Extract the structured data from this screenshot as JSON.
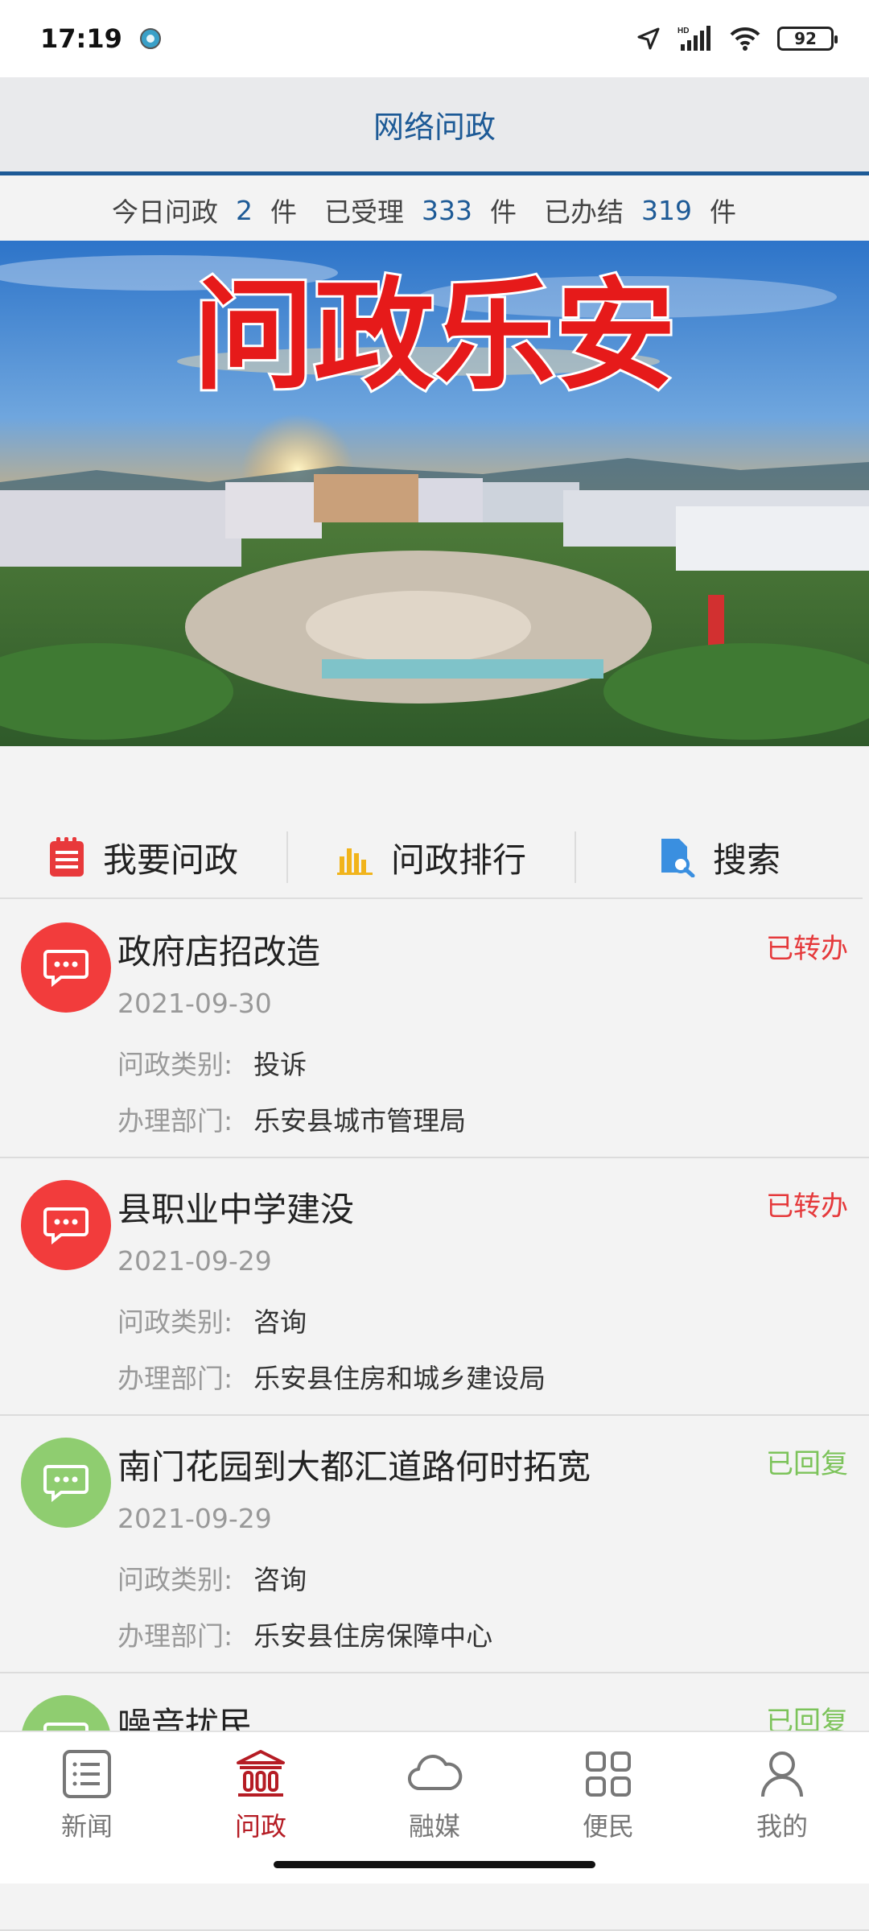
{
  "status_bar": {
    "time": "17:19",
    "battery": "92"
  },
  "header": {
    "title": "网络问政"
  },
  "stats": {
    "today_label": "今日问政",
    "today_value": "2",
    "accepted_label": "已受理",
    "accepted_value": "333",
    "done_label": "已办结",
    "done_value": "319",
    "unit": "件"
  },
  "banner": {
    "headline": "问政乐安"
  },
  "actions": [
    {
      "label": "我要问政",
      "icon": "notepad-icon"
    },
    {
      "label": "问政排行",
      "icon": "bar-chart-icon"
    },
    {
      "label": "搜索",
      "icon": "search-doc-icon"
    }
  ],
  "field_labels": {
    "category": "问政类别:",
    "department": "办理部门:"
  },
  "items": [
    {
      "title": "政府店招改造",
      "status": "已转办",
      "date": "2021-09-30",
      "category": "投诉",
      "department": "乐安县城市管理局",
      "color": "#f23c3c",
      "status_color": "#e5393b"
    },
    {
      "title": "县职业中学建没",
      "status": "已转办",
      "date": "2021-09-29",
      "category": "咨询",
      "department": "乐安县住房和城乡建设局",
      "color": "#f23c3c",
      "status_color": "#e5393b"
    },
    {
      "title": "南门花园到大都汇道路何时拓宽",
      "status": "已回复",
      "date": "2021-09-29",
      "category": "咨询",
      "department": "乐安县住房保障中心",
      "color": "#8fcd70",
      "status_color": "#7cc35a"
    },
    {
      "title": "噪音扰民",
      "status": "已回复",
      "date": "",
      "category": "",
      "department": "",
      "color": "#8fcd70",
      "status_color": "#7cc35a"
    }
  ],
  "tabs": [
    {
      "label": "新闻",
      "icon": "news-list-icon"
    },
    {
      "label": "问政",
      "icon": "government-building-icon"
    },
    {
      "label": "融媒",
      "icon": "cloud-icon"
    },
    {
      "label": "便民",
      "icon": "grid-apps-icon"
    },
    {
      "label": "我的",
      "icon": "person-icon"
    }
  ],
  "colors": {
    "brand_blue": "#1d5a96",
    "active_tab": "#b51c24"
  }
}
